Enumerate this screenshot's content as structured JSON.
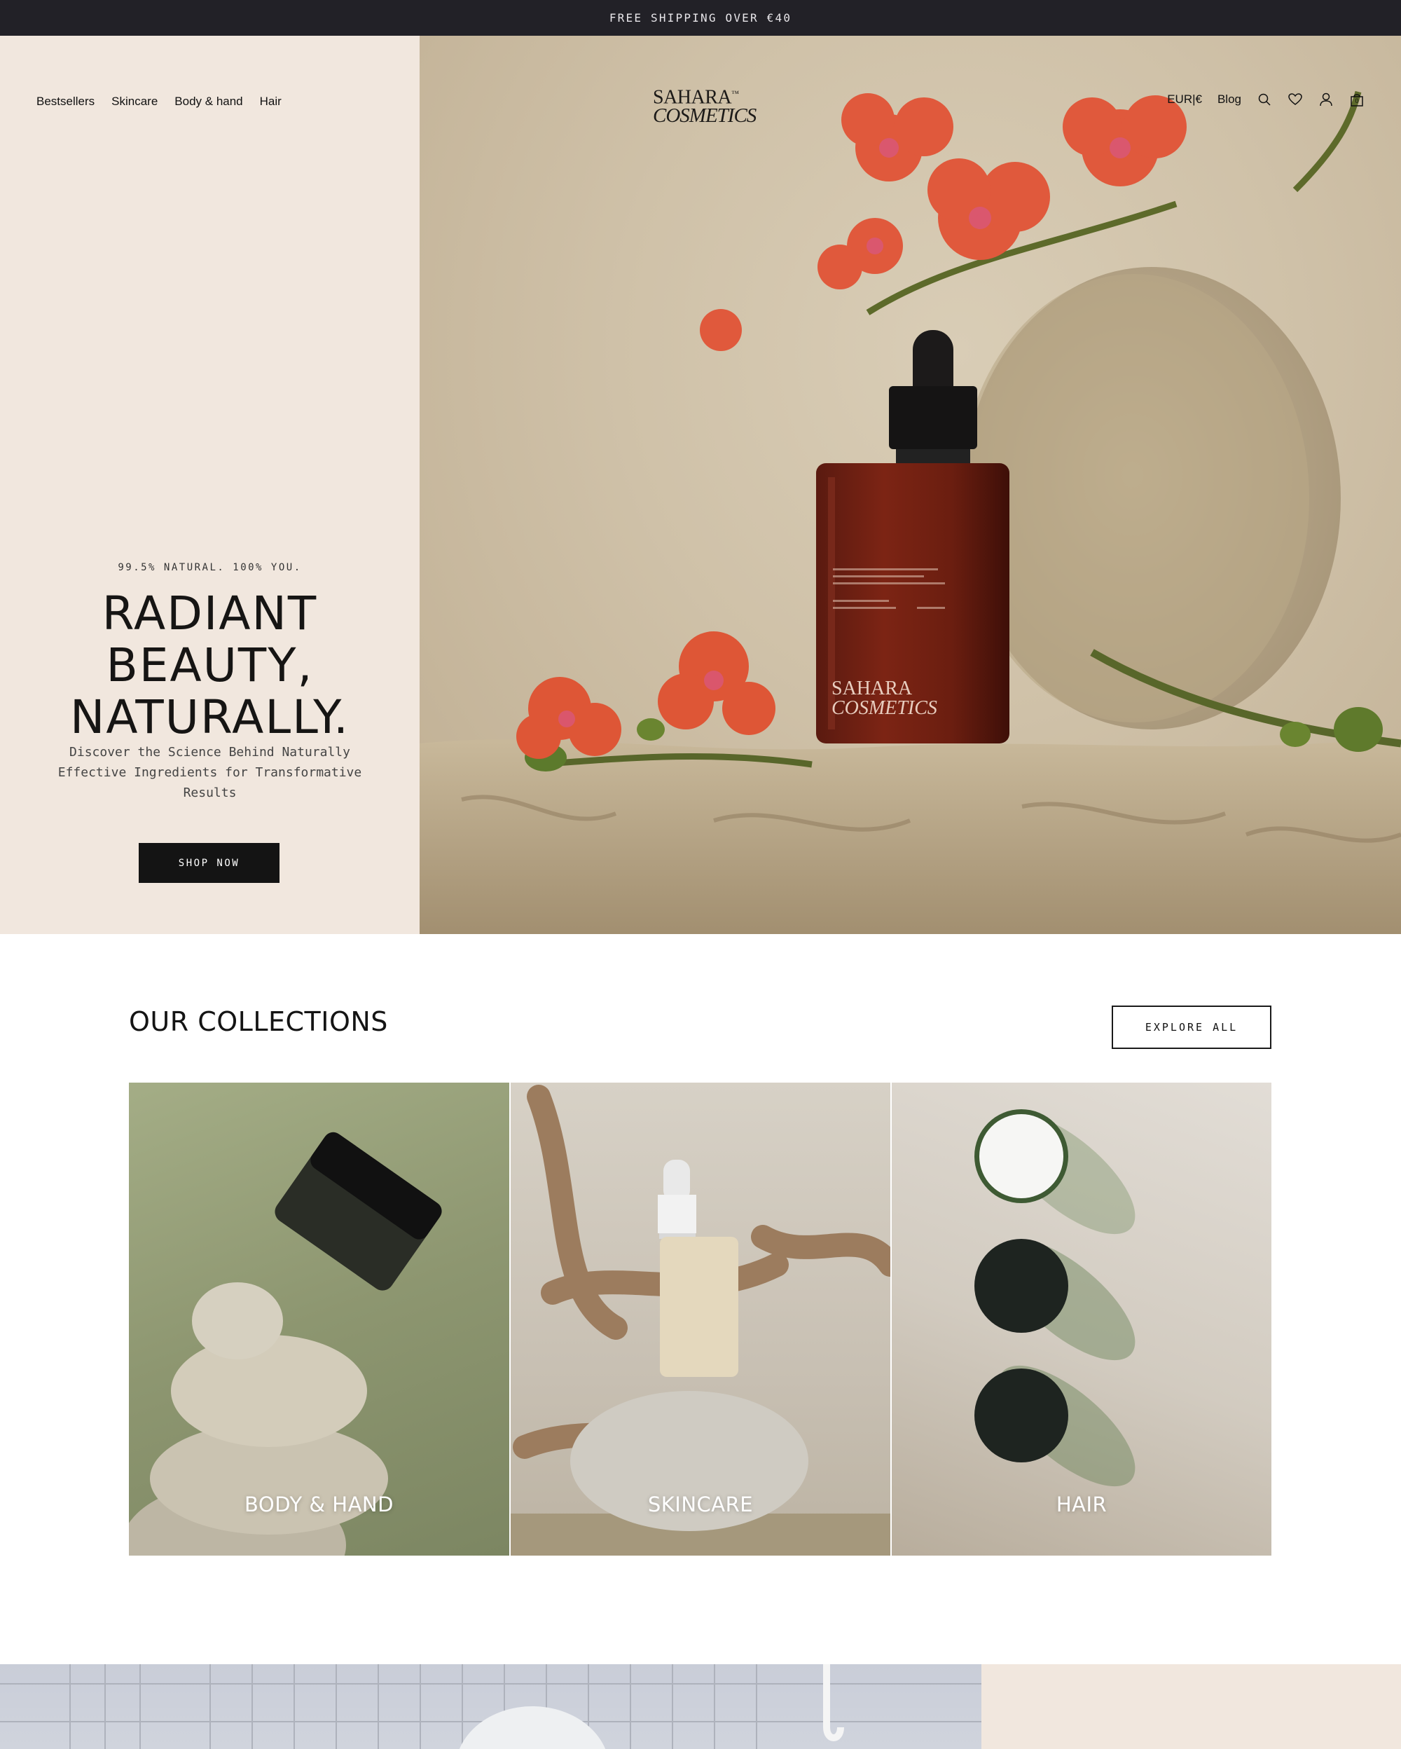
{
  "announcement": {
    "text": "FREE SHIPPING OVER €40"
  },
  "header": {
    "nav": [
      {
        "label": "Bestsellers"
      },
      {
        "label": "Skincare"
      },
      {
        "label": "Body & hand"
      },
      {
        "label": "Hair"
      }
    ],
    "logo": {
      "line1": "SAHARA",
      "tm": "™",
      "line2": "COSMETICS"
    },
    "currency": "EUR|€",
    "blog": "Blog",
    "icons": [
      "search-icon",
      "heart-icon",
      "account-icon",
      "bag-icon"
    ],
    "cart_count": "0"
  },
  "hero": {
    "eyebrow": "99.5% NATURAL. 100% YOU.",
    "title_lines": [
      "RADIANT",
      "BEAUTY,",
      "NATURALLY."
    ],
    "subtitle": "Discover the Science Behind Naturally Effective Ingredients for Transformative Results",
    "cta": "SHOP NOW",
    "bottle_label": {
      "line1": "SAHARA",
      "line2": "COSMETICS"
    }
  },
  "collections": {
    "title": "OUR COLLECTIONS",
    "explore": "EXPLORE ALL",
    "items": [
      {
        "label": "BODY & HAND"
      },
      {
        "label": "SKINCARE"
      },
      {
        "label": "HAIR"
      }
    ]
  },
  "colors": {
    "announcement_bg": "#222127",
    "hero_left_bg": "#f1e7de",
    "button_dark": "#141414"
  }
}
